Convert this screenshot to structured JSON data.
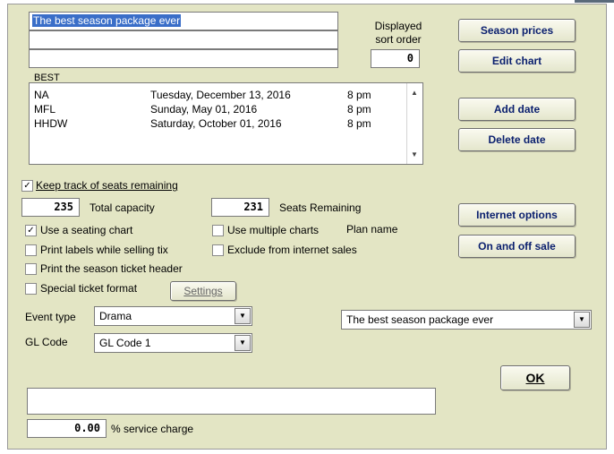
{
  "season": {
    "name_line1": "The best season package ever",
    "name_line2": "",
    "name_line3": "",
    "code": "BEST",
    "sort_order_label_1": "Displayed",
    "sort_order_label_2": "sort order",
    "sort_order": "0"
  },
  "buttons": {
    "season_prices": "Season prices",
    "edit_chart": "Edit chart",
    "add_date": "Add date",
    "delete_date": "Delete date",
    "internet_options": "Internet options",
    "on_off_sale": "On and off sale",
    "settings": "Settings",
    "ok": "OK"
  },
  "dates": [
    {
      "code": "NA",
      "date": "Tuesday, December 13, 2016",
      "time": "8 pm"
    },
    {
      "code": "MFL",
      "date": "Sunday, May 01, 2016",
      "time": "8 pm"
    },
    {
      "code": "HHDW",
      "date": "Saturday, October 01, 2016",
      "time": "8 pm"
    }
  ],
  "options": {
    "keep_track": {
      "label": "Keep track of seats remaining",
      "checked": true
    },
    "total_capacity_value": "235",
    "total_capacity_label": "Total capacity",
    "seats_remaining_value": "231",
    "seats_remaining_label": "Seats Remaining",
    "use_seating_chart": {
      "label": "Use a seating chart",
      "checked": true
    },
    "use_multiple_charts": {
      "label": "Use multiple charts",
      "checked": false
    },
    "plan_name_label": "Plan name",
    "print_labels": {
      "label": "Print labels while selling tix",
      "checked": false
    },
    "exclude_internet": {
      "label": "Exclude from internet sales",
      "checked": false
    },
    "print_header": {
      "label": "Print the season ticket header",
      "checked": false
    },
    "special_format": {
      "label": "Special ticket format",
      "checked": false
    }
  },
  "event_type": {
    "label": "Event type",
    "value": "Drama"
  },
  "gl_code": {
    "label": "GL Code",
    "value": "GL Code 1"
  },
  "plan_select": {
    "value": "The best season package ever"
  },
  "notes": "",
  "service_charge": {
    "value": "0.00",
    "label": "% service charge"
  },
  "colors": {
    "panel": "#e3e5c4",
    "button_text": "#0a1f6e",
    "selection": "#3a6ec8"
  }
}
